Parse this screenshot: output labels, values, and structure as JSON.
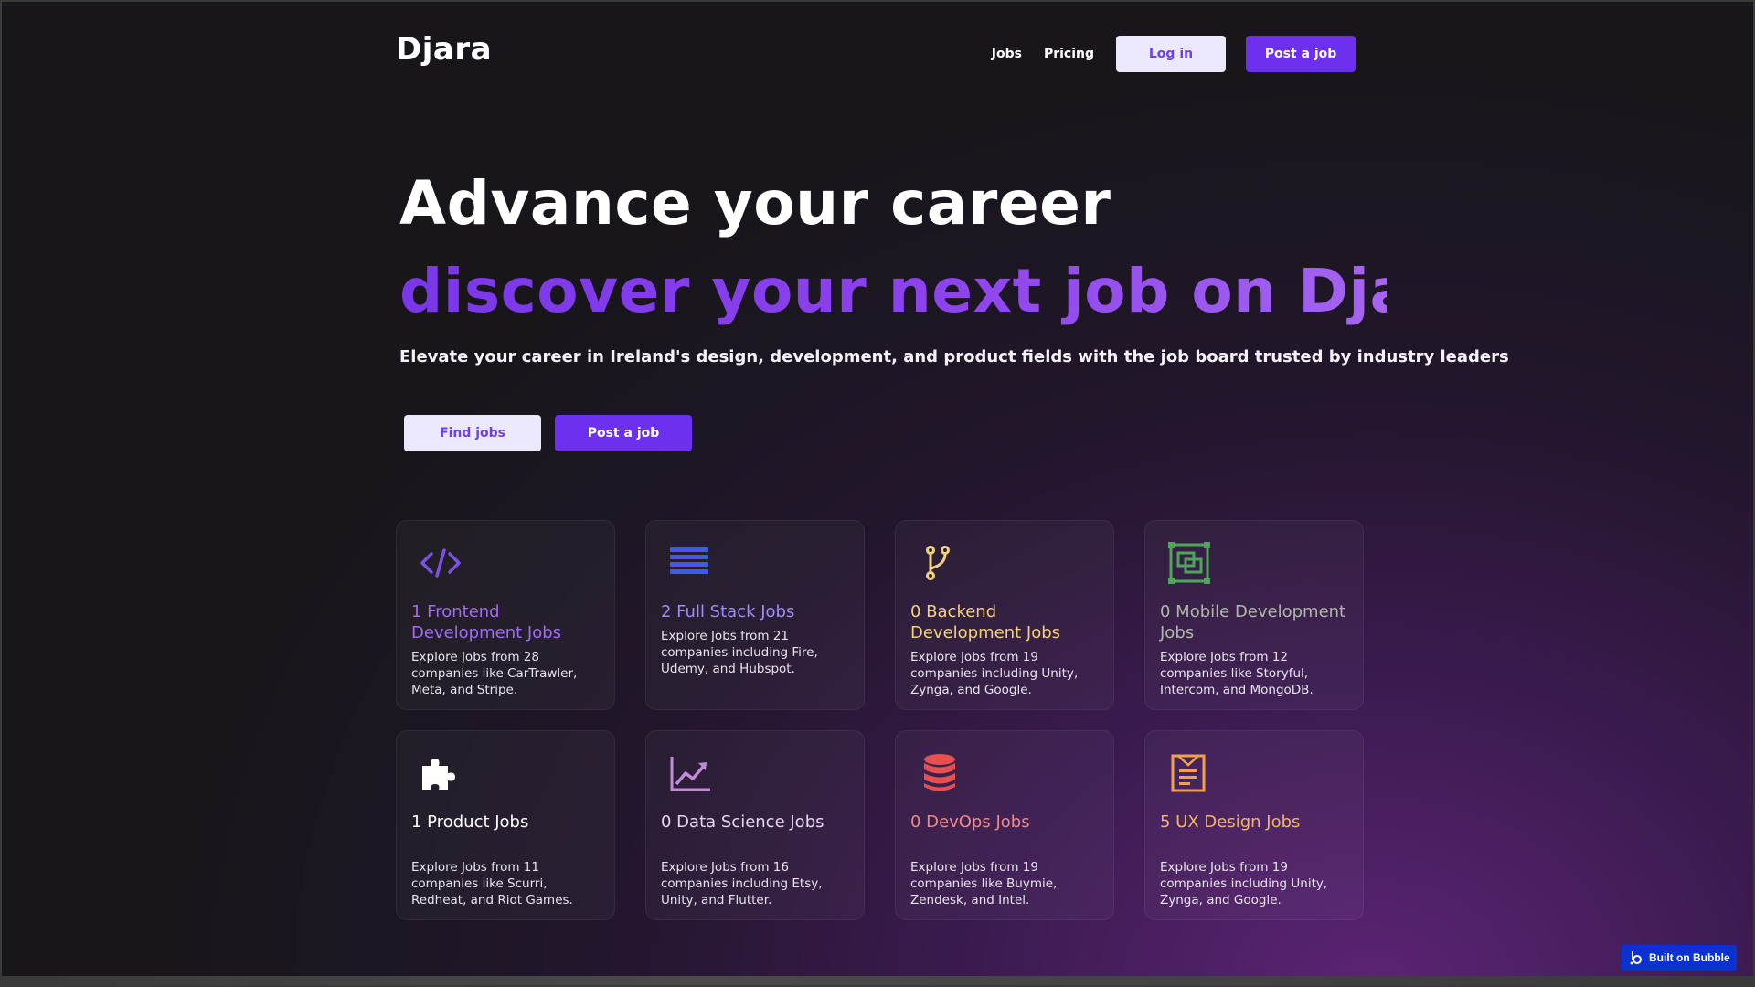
{
  "header": {
    "logo": "Djara",
    "nav": {
      "jobs": "Jobs",
      "pricing": "Pricing"
    },
    "login": "Log in",
    "post_job": "Post a job"
  },
  "hero": {
    "title": "Advance your career",
    "subtitle": "discover your next job on Djara",
    "description": "Elevate your career in Ireland's design, development, and product fields with the job board trusted by industry leaders",
    "find_jobs": "Find jobs",
    "post_job": "Post a job"
  },
  "categories": [
    {
      "title": "1 Frontend Development Jobs",
      "description": "Explore Jobs from 28 companies like CarTrawler, Meta, and Stripe.",
      "icon": "code-icon",
      "color": "#9f6cf5"
    },
    {
      "title": "2 Full Stack Jobs",
      "description": "Explore Jobs from 21 companies including Fire, Udemy, and Hubspot.",
      "icon": "list-icon",
      "color": "#9f8ef6"
    },
    {
      "title": "0 Backend Development Jobs",
      "description": "Explore Jobs from 19 companies including Unity, Zynga, and Google.",
      "icon": "git-branch-icon",
      "color": "#f3d27c"
    },
    {
      "title": "0 Mobile Development Jobs",
      "description": "Explore Jobs from 12 companies like Storyful, Intercom, and MongoDB.",
      "icon": "devices-icon",
      "color": "#b0b8a9"
    },
    {
      "title": "1 Product Jobs",
      "description": "Explore Jobs from 11 companies like Scurri, Redheat, and Riot Games.",
      "icon": "puzzle-icon",
      "color": "#ffffff"
    },
    {
      "title": "0 Data Science Jobs",
      "description": "Explore Jobs from 16 companies including Etsy, Unity, and Flutter.",
      "icon": "chart-line-icon",
      "color": "#e6d7f0"
    },
    {
      "title": "0 DevOps Jobs",
      "description": "Explore Jobs from 19 companies like Buymie, Zendesk, and Intel.",
      "icon": "database-icon",
      "color": "#f08a8a"
    },
    {
      "title": "5 UX Design Jobs",
      "description": "Explore Jobs from 19 companies including Unity, Zynga, and Google.",
      "icon": "design-doc-icon",
      "color": "#f3b56a"
    }
  ],
  "badge": {
    "label": "Built on Bubble"
  },
  "colors": {
    "accent": "#6c30ee",
    "light_button": "#ece8fb",
    "badge": "#0b31d1"
  }
}
